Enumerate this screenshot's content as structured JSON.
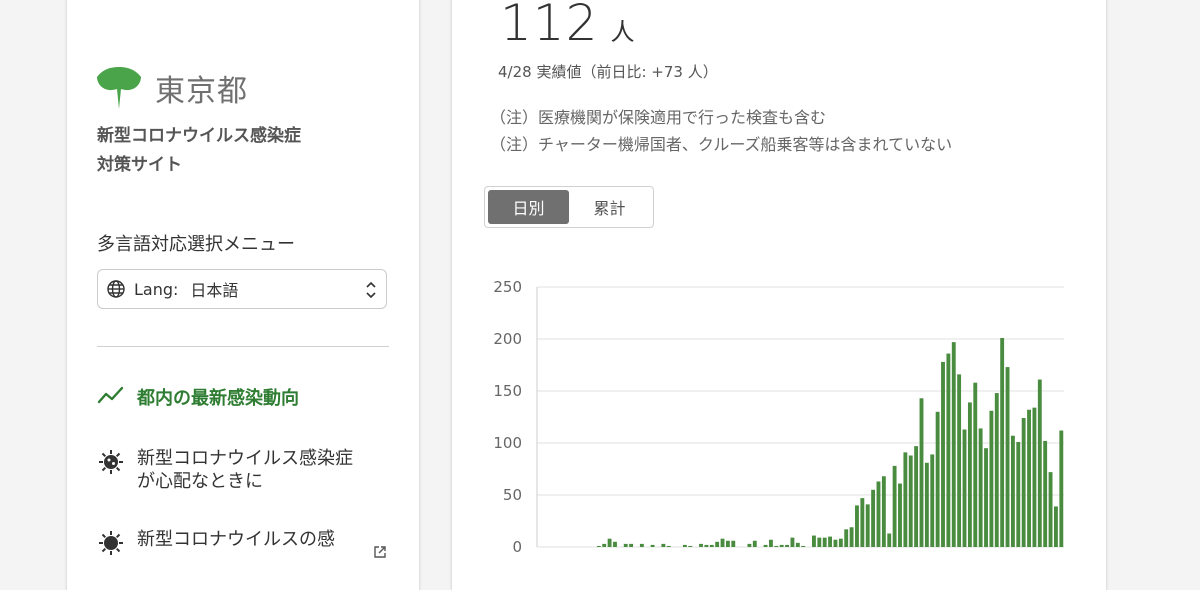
{
  "sidebar": {
    "logo_text": "東京都",
    "site_title_line1": "新型コロナウイルス感染症",
    "site_title_line2": "対策サイト",
    "lang_menu_label": "多言語対応選択メニュー",
    "lang_prefix": "Lang:",
    "lang_value": "日本語",
    "nav": [
      {
        "label": "都内の最新感染動向",
        "icon": "trend-line-icon",
        "active": true
      },
      {
        "label_line1": "新型コロナウイルス感染症",
        "label_line2": "が心配なときに",
        "icon": "virus-icon"
      },
      {
        "label_line1": "新型コロナウイルスの感",
        "icon": "virus-icon",
        "external": true
      }
    ]
  },
  "card": {
    "value": "112",
    "unit": "人",
    "sub_value": "4/28 実績値（前日比: +73 人）",
    "notes": [
      "（注）医療機関が保険適用で行った検査も含む",
      "（注）チャーター機帰国者、クルーズ船乗客等は含まれていない"
    ],
    "toggle": {
      "daily": "日別",
      "cumulative": "累計",
      "selected": "daily"
    }
  },
  "colors": {
    "accent_green": "#2e7d32",
    "bar_green": "#4a8c3f",
    "logo_green": "#4aa44a"
  },
  "chart_data": {
    "type": "bar",
    "title": "",
    "xlabel": "",
    "ylabel": "",
    "ylim": [
      0,
      250
    ],
    "yticks": [
      0,
      50,
      100,
      150,
      200,
      250
    ],
    "grid": true,
    "series": [
      {
        "values": [
          0,
          0,
          0,
          0,
          0,
          0,
          0,
          0,
          0,
          0,
          0,
          1,
          3,
          8,
          5,
          0,
          3,
          3,
          0,
          3,
          0,
          2,
          0,
          3,
          1,
          0,
          0,
          2,
          1,
          0,
          3,
          2,
          2,
          5,
          8,
          6,
          6,
          0,
          0,
          3,
          6,
          0,
          2,
          7,
          1,
          2,
          2,
          9,
          4,
          1,
          0,
          11,
          9,
          9,
          10,
          7,
          8,
          17,
          19,
          40,
          47,
          41,
          55,
          63,
          68,
          13,
          78,
          61,
          91,
          88,
          97,
          143,
          81,
          89,
          130,
          178,
          186,
          197,
          166,
          113,
          139,
          158,
          114,
          95,
          131,
          148,
          201,
          173,
          107,
          101,
          124,
          132,
          134,
          161,
          102,
          72,
          39,
          112
        ]
      }
    ]
  }
}
